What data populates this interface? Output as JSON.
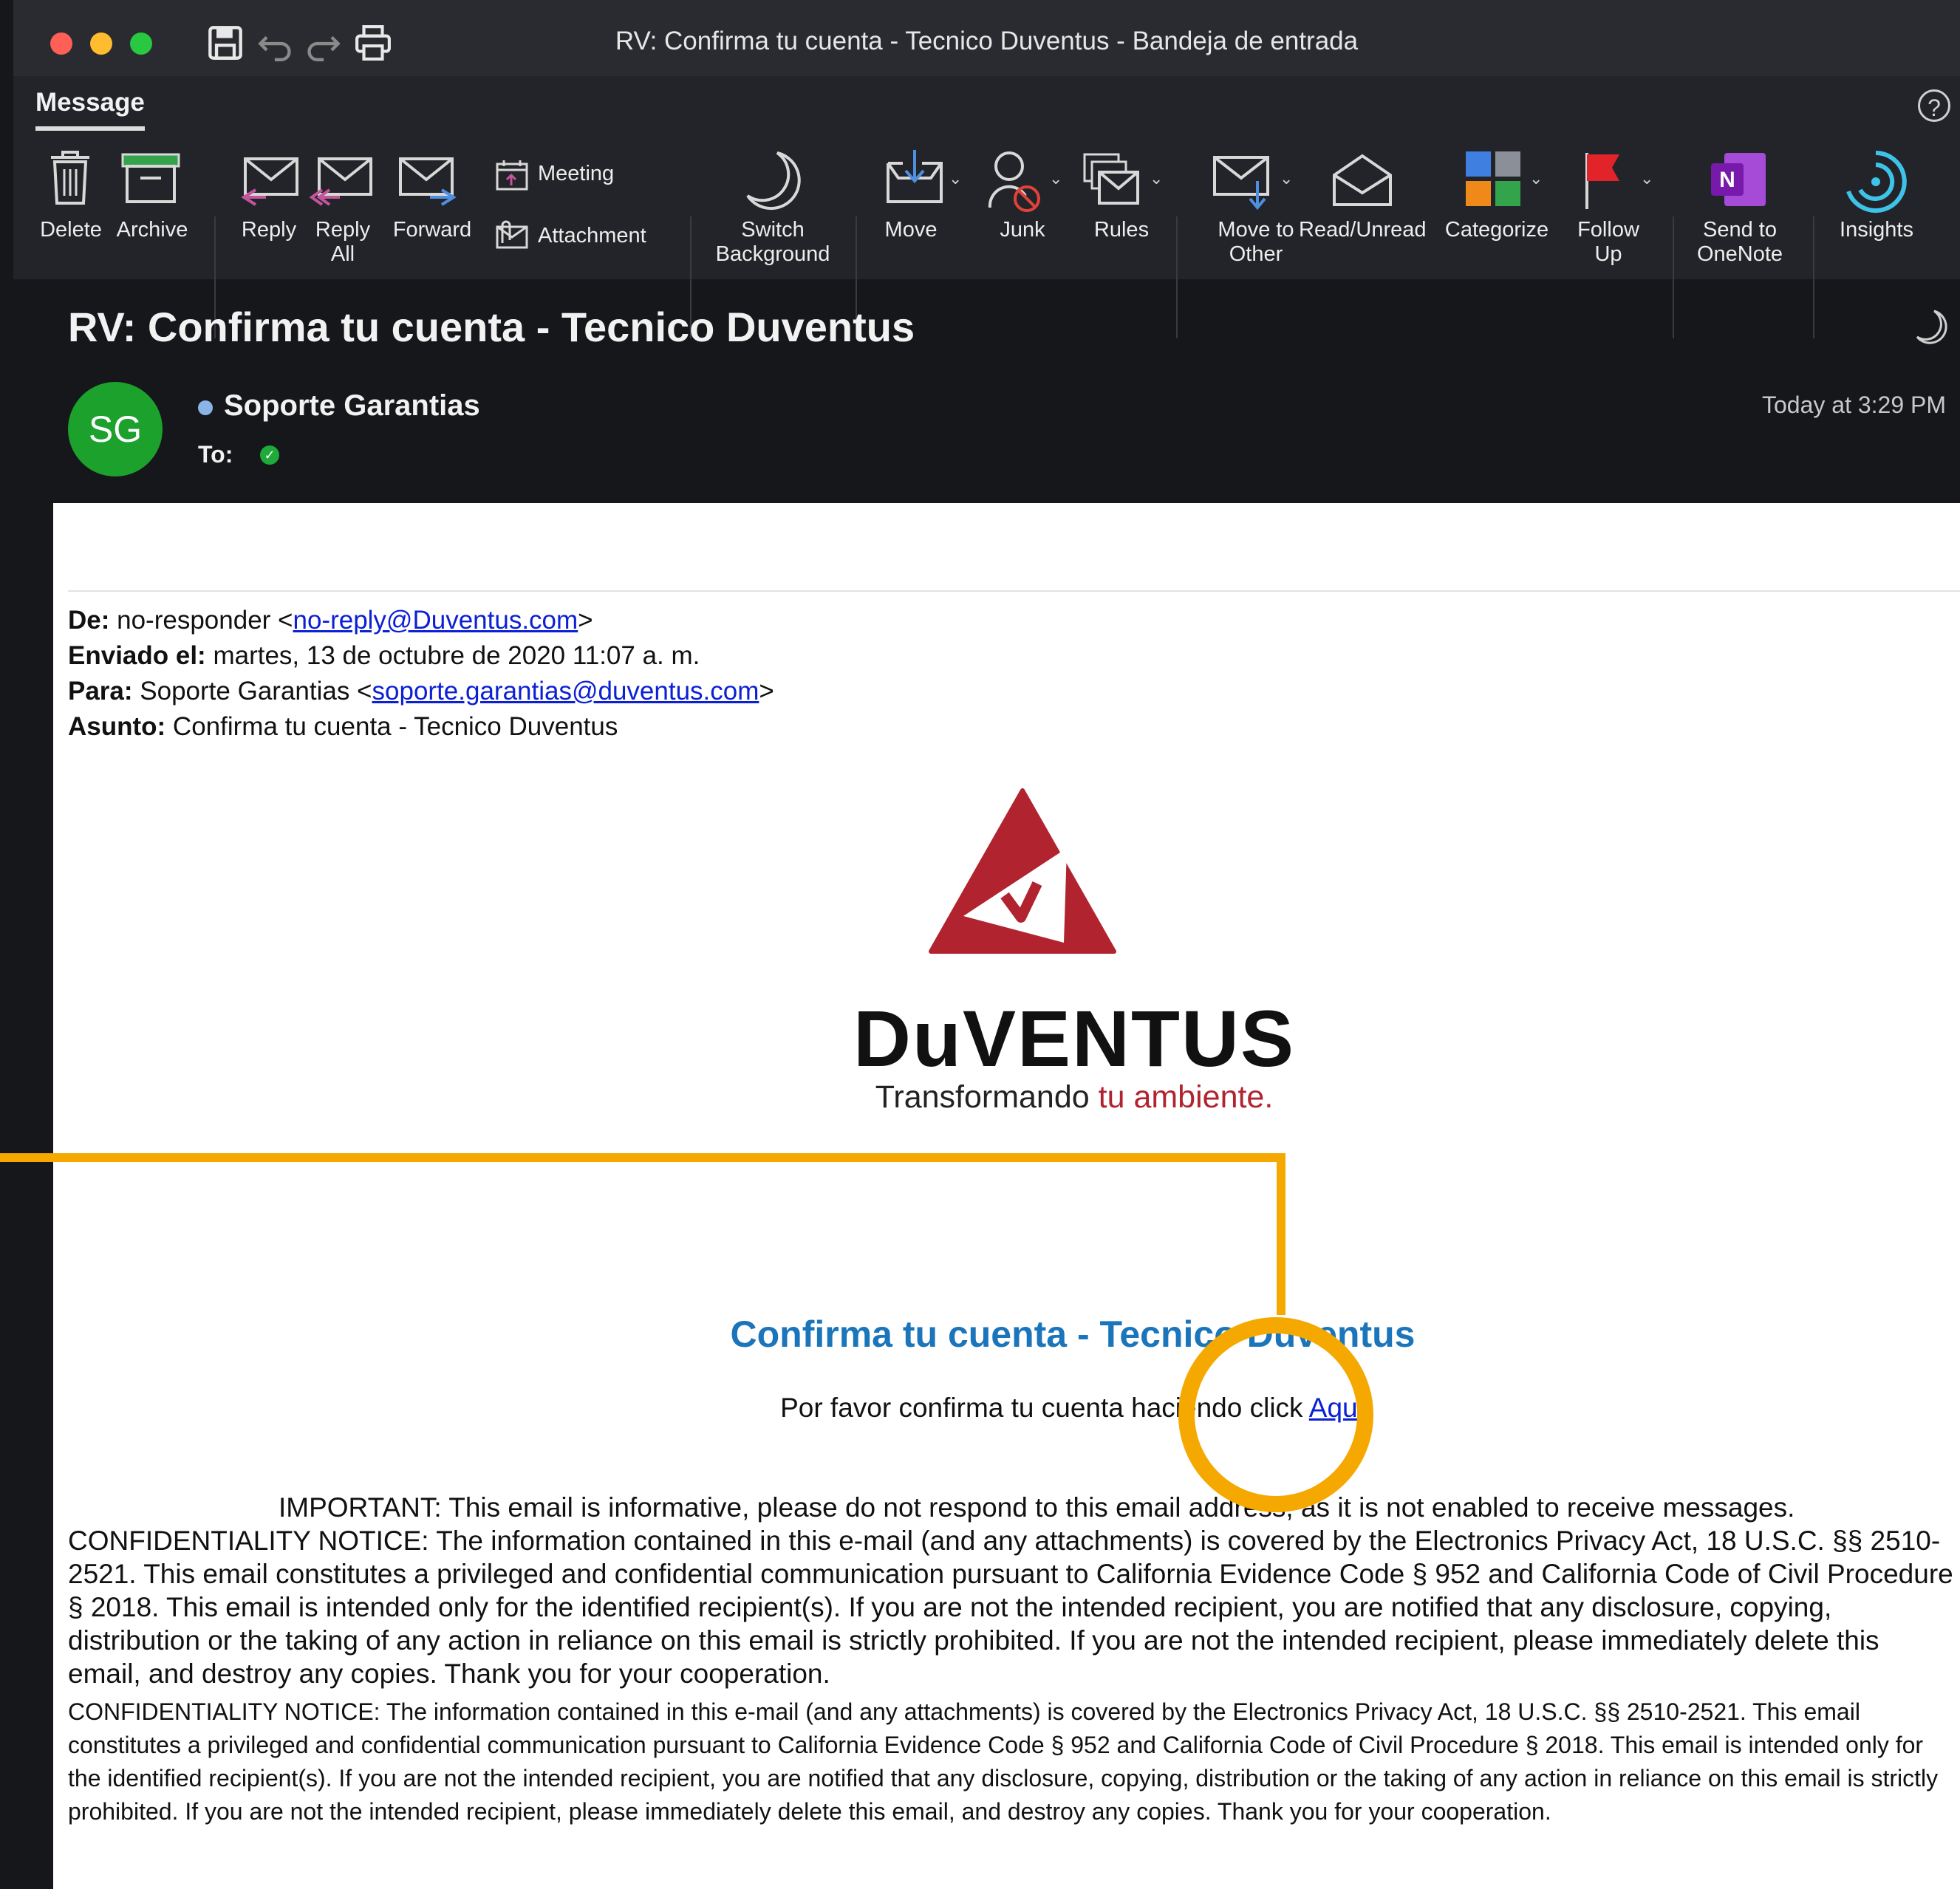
{
  "window": {
    "title": "RV: Confirma tu cuenta - Tecnico Duventus - Bandeja de entrada"
  },
  "ribbon": {
    "tab": "Message",
    "help": "?",
    "buttons": {
      "delete": "Delete",
      "archive": "Archive",
      "reply": "Reply",
      "reply_all_1": "Reply",
      "reply_all_2": "All",
      "forward": "Forward",
      "meeting": "Meeting",
      "attachment": "Attachment",
      "switch_bg_1": "Switch",
      "switch_bg_2": "Background",
      "move": "Move",
      "junk": "Junk",
      "rules": "Rules",
      "move_other_1": "Move to",
      "move_other_2": "Other",
      "read_unread": "Read/Unread",
      "categorize": "Categorize",
      "follow_up_1": "Follow",
      "follow_up_2": "Up",
      "onenote_1": "Send to",
      "onenote_2": "OneNote",
      "insights": "Insights"
    }
  },
  "header": {
    "subject": "RV: Confirma tu cuenta - Tecnico Duventus",
    "avatar_initials": "SG",
    "sender": "Soporte Garantias",
    "to_label": "To:",
    "timestamp": "Today at 3:29 PM"
  },
  "forwarded": {
    "from_label": "De:",
    "from_name": " no-responder <",
    "from_email": "no-reply@Duventus.com",
    "from_close": ">",
    "sent_label": "Enviado el:",
    "sent_value": " martes, 13 de octubre de 2020 11:07 a. m.",
    "to_label": "Para:",
    "to_name": " Soporte Garantias <",
    "to_email": "soporte.garantias@duventus.com",
    "to_close": ">",
    "subject_label": "Asunto:",
    "subject_value": " Confirma tu cuenta - Tecnico Duventus"
  },
  "logo": {
    "wordmark": "DuVENTUS",
    "tagline_start": "Transformando ",
    "tagline_accent": "tu ambiente."
  },
  "content": {
    "heading": "Confirma tu cuenta - Tecnico Duventus",
    "line_text": "Por favor confirma tu cuenta haciendo click ",
    "link": "Aquí",
    "important": "IMPORTANT: This email is informative, please do not respond to this email address, as it is not enabled to receive messages.",
    "notice_large": "CONFIDENTIALITY NOTICE: The information contained in this e-mail (and any attachments) is covered by the Electronics Privacy Act, 18 U.S.C. §§ 2510-2521. This email constitutes a privileged and confidential communication pursuant to California Evidence Code § 952 and California Code of Civil Procedure § 2018. This email is intended only for the identified recipient(s). If you are not the intended recipient, you are notified that any disclosure, copying, distribution or the taking of any action in reliance on this email is strictly prohibited. If you are not the intended recipient, please immediately delete this email, and destroy any copies. Thank you for your cooperation.",
    "notice_small": "CONFIDENTIALITY NOTICE: The information contained in this e-mail (and any attachments) is covered by the Electronics Privacy Act, 18 U.S.C. §§ 2510-2521. This email constitutes a privileged and confidential communication pursuant to California Evidence Code § 952 and California Code of Civil Procedure § 2018. This email is intended only for the identified recipient(s). If you are not the intended recipient, you are notified that any disclosure, copying, distribution or the taking of any action in reliance on this email is strictly prohibited. If you are not the intended recipient, please immediately delete this email, and destroy any copies. Thank you for your cooperation."
  },
  "colors": {
    "avatar": "#1ca12c",
    "link": "#0b1fd4",
    "heading": "#1b75bb",
    "brand_red": "#b1232f",
    "callout": "#f5a800"
  }
}
